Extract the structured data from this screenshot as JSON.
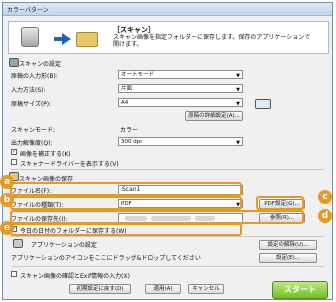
{
  "window": {
    "title": "カラーパターン"
  },
  "header": {
    "title": "［スキャン］",
    "description": "スキャン画像を指定フォルダーに保存します。保存のアプリケーションで開けます。"
  },
  "scan_settings": {
    "heading": "スキャンの設定",
    "input_size_label": "原稿の入力形(B):",
    "input_size_value": "オートモード",
    "input_method_label": "入力方法(S):",
    "input_method_value": "片面",
    "paper_size_label": "原稿サイズ(P):",
    "paper_size_value": "A4",
    "detail_button": "原稿の詳細設定(A)...",
    "scan_mode_label": "スキャンモード:",
    "scan_mode_value": "カラー",
    "resolution_label": "出力解像度(Q):",
    "resolution_value": "300 dpi",
    "correct_slant_label": "画像を補正する(K)",
    "show_driver_label": "スキャナードライバーを表示する(V)"
  },
  "save_settings": {
    "heading": "スキャン画像の保存",
    "file_name_label": "ファイル名(F):",
    "file_name_value": "Scan1",
    "file_type_label": "ファイルの種類(T):",
    "file_type_value": "PDF",
    "pdf_settings_button": "PDF設定(G)...",
    "save_location_label": "ファイルの保存先(I):",
    "browse_button": "参照(R)...",
    "date_folder_label": "今日の日付のフォルダーに保存する(W)"
  },
  "app_settings": {
    "heading": "アプリケーションの設定",
    "description": "アプリケーションのアイコンをここにドラッグ&ドロップしてください。",
    "app_settings_button": "設定の解除(U)...",
    "settings_button": "設定(E)..."
  },
  "footer": {
    "confirm_label": "スキャン画像の確認とExif情報の入力(X)",
    "reset_button": "初期設定に戻す(D)",
    "apply_button": "適用(A)",
    "cancel_button": "キャンセル",
    "start_button": "スタート"
  },
  "callouts": [
    "a",
    "b",
    "c",
    "d",
    "e"
  ],
  "colors": {
    "highlight": "#e59a23",
    "start": "#6fbf2a"
  }
}
